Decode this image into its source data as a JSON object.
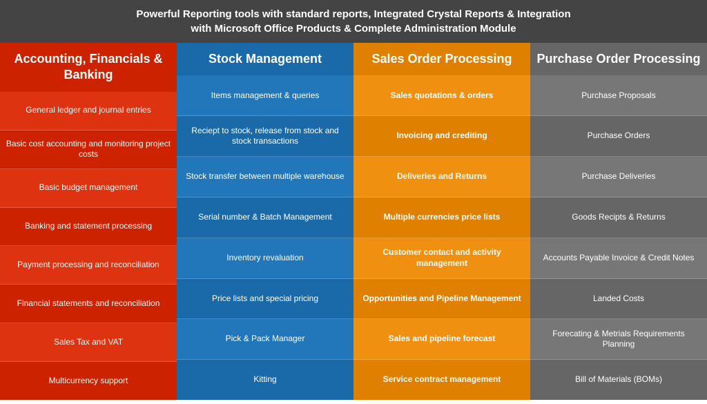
{
  "header": {
    "line1": "Powerful Reporting tools with standard reports, Integrated Crystal Reports & Integration",
    "line2": "with Microsoft Office Products & Complete Administration Module"
  },
  "columns": [
    {
      "id": "accounting",
      "class": "col-accounting",
      "header": "Accounting, Financials & Banking",
      "items": [
        "General ledger and journal entries",
        "Basic cost accounting and monitoring project costs",
        "Basic budget management",
        "Banking and statement processing",
        "Payment processing and reconciliation",
        "Financial statements and reconciliation",
        "Sales Tax and VAT",
        "Multicurrency support"
      ]
    },
    {
      "id": "stock",
      "class": "col-stock",
      "header": "Stock Management",
      "items": [
        "Items management & queries",
        "Reciept to stock, release from stock and stock transactions",
        "Stock transfer between multiple warehouse",
        "Serial number & Batch Management",
        "Inventory revaluation",
        "Price lists and special pricing",
        "Pick & Pack Manager",
        "Kitting"
      ]
    },
    {
      "id": "sales",
      "class": "col-sales",
      "header": "Sales Order Processing",
      "items": [
        "Sales quotations & orders",
        "Invoicing and crediting",
        "Deliveries and Returns",
        "Multiple currencies price lists",
        "Customer contact and activity management",
        "Opportunities and Pipeline Management",
        "Sales and pipeline forecast",
        "Service contract management"
      ]
    },
    {
      "id": "purchase",
      "class": "col-purchase",
      "header": "Purchase Order Processing",
      "items": [
        "Purchase Proposals",
        "Purchase Orders",
        "Purchase Deliveries",
        "Goods Recipts & Returns",
        "Accounts Payable Invoice & Credit Notes",
        "Landed Costs",
        "Forecating & Metrials Requirements Planning",
        "Bill of Materials (BOMs)"
      ]
    }
  ]
}
